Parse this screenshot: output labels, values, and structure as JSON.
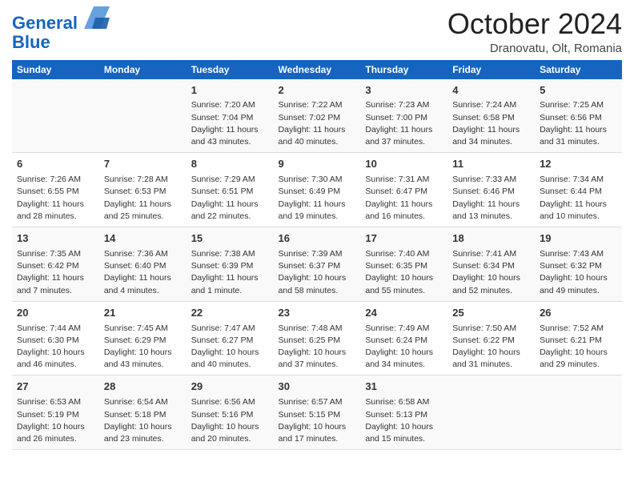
{
  "header": {
    "logo_line1": "General",
    "logo_line2": "Blue",
    "month_title": "October 2024",
    "location": "Dranovatu, Olt, Romania"
  },
  "weekdays": [
    "Sunday",
    "Monday",
    "Tuesday",
    "Wednesday",
    "Thursday",
    "Friday",
    "Saturday"
  ],
  "weeks": [
    [
      {
        "day": "",
        "info": ""
      },
      {
        "day": "",
        "info": ""
      },
      {
        "day": "1",
        "info": "Sunrise: 7:20 AM\nSunset: 7:04 PM\nDaylight: 11 hours and 43 minutes."
      },
      {
        "day": "2",
        "info": "Sunrise: 7:22 AM\nSunset: 7:02 PM\nDaylight: 11 hours and 40 minutes."
      },
      {
        "day": "3",
        "info": "Sunrise: 7:23 AM\nSunset: 7:00 PM\nDaylight: 11 hours and 37 minutes."
      },
      {
        "day": "4",
        "info": "Sunrise: 7:24 AM\nSunset: 6:58 PM\nDaylight: 11 hours and 34 minutes."
      },
      {
        "day": "5",
        "info": "Sunrise: 7:25 AM\nSunset: 6:56 PM\nDaylight: 11 hours and 31 minutes."
      }
    ],
    [
      {
        "day": "6",
        "info": "Sunrise: 7:26 AM\nSunset: 6:55 PM\nDaylight: 11 hours and 28 minutes."
      },
      {
        "day": "7",
        "info": "Sunrise: 7:28 AM\nSunset: 6:53 PM\nDaylight: 11 hours and 25 minutes."
      },
      {
        "day": "8",
        "info": "Sunrise: 7:29 AM\nSunset: 6:51 PM\nDaylight: 11 hours and 22 minutes."
      },
      {
        "day": "9",
        "info": "Sunrise: 7:30 AM\nSunset: 6:49 PM\nDaylight: 11 hours and 19 minutes."
      },
      {
        "day": "10",
        "info": "Sunrise: 7:31 AM\nSunset: 6:47 PM\nDaylight: 11 hours and 16 minutes."
      },
      {
        "day": "11",
        "info": "Sunrise: 7:33 AM\nSunset: 6:46 PM\nDaylight: 11 hours and 13 minutes."
      },
      {
        "day": "12",
        "info": "Sunrise: 7:34 AM\nSunset: 6:44 PM\nDaylight: 11 hours and 10 minutes."
      }
    ],
    [
      {
        "day": "13",
        "info": "Sunrise: 7:35 AM\nSunset: 6:42 PM\nDaylight: 11 hours and 7 minutes."
      },
      {
        "day": "14",
        "info": "Sunrise: 7:36 AM\nSunset: 6:40 PM\nDaylight: 11 hours and 4 minutes."
      },
      {
        "day": "15",
        "info": "Sunrise: 7:38 AM\nSunset: 6:39 PM\nDaylight: 11 hours and 1 minute."
      },
      {
        "day": "16",
        "info": "Sunrise: 7:39 AM\nSunset: 6:37 PM\nDaylight: 10 hours and 58 minutes."
      },
      {
        "day": "17",
        "info": "Sunrise: 7:40 AM\nSunset: 6:35 PM\nDaylight: 10 hours and 55 minutes."
      },
      {
        "day": "18",
        "info": "Sunrise: 7:41 AM\nSunset: 6:34 PM\nDaylight: 10 hours and 52 minutes."
      },
      {
        "day": "19",
        "info": "Sunrise: 7:43 AM\nSunset: 6:32 PM\nDaylight: 10 hours and 49 minutes."
      }
    ],
    [
      {
        "day": "20",
        "info": "Sunrise: 7:44 AM\nSunset: 6:30 PM\nDaylight: 10 hours and 46 minutes."
      },
      {
        "day": "21",
        "info": "Sunrise: 7:45 AM\nSunset: 6:29 PM\nDaylight: 10 hours and 43 minutes."
      },
      {
        "day": "22",
        "info": "Sunrise: 7:47 AM\nSunset: 6:27 PM\nDaylight: 10 hours and 40 minutes."
      },
      {
        "day": "23",
        "info": "Sunrise: 7:48 AM\nSunset: 6:25 PM\nDaylight: 10 hours and 37 minutes."
      },
      {
        "day": "24",
        "info": "Sunrise: 7:49 AM\nSunset: 6:24 PM\nDaylight: 10 hours and 34 minutes."
      },
      {
        "day": "25",
        "info": "Sunrise: 7:50 AM\nSunset: 6:22 PM\nDaylight: 10 hours and 31 minutes."
      },
      {
        "day": "26",
        "info": "Sunrise: 7:52 AM\nSunset: 6:21 PM\nDaylight: 10 hours and 29 minutes."
      }
    ],
    [
      {
        "day": "27",
        "info": "Sunrise: 6:53 AM\nSunset: 5:19 PM\nDaylight: 10 hours and 26 minutes."
      },
      {
        "day": "28",
        "info": "Sunrise: 6:54 AM\nSunset: 5:18 PM\nDaylight: 10 hours and 23 minutes."
      },
      {
        "day": "29",
        "info": "Sunrise: 6:56 AM\nSunset: 5:16 PM\nDaylight: 10 hours and 20 minutes."
      },
      {
        "day": "30",
        "info": "Sunrise: 6:57 AM\nSunset: 5:15 PM\nDaylight: 10 hours and 17 minutes."
      },
      {
        "day": "31",
        "info": "Sunrise: 6:58 AM\nSunset: 5:13 PM\nDaylight: 10 hours and 15 minutes."
      },
      {
        "day": "",
        "info": ""
      },
      {
        "day": "",
        "info": ""
      }
    ]
  ]
}
